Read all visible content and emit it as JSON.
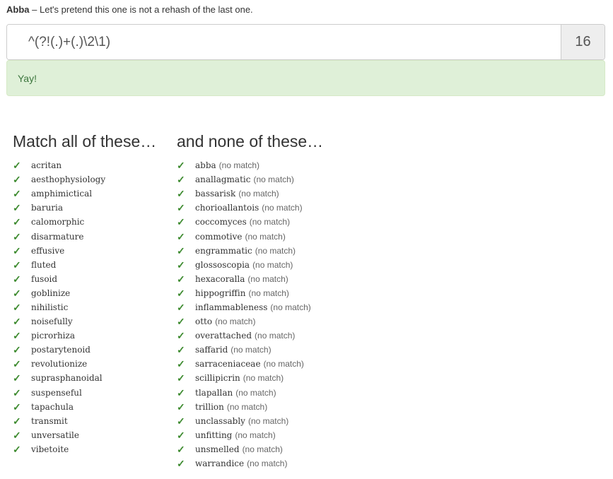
{
  "puzzle": {
    "name": "Abba",
    "separator": "–",
    "description": "Let's pretend this one is not a rehash of the last one."
  },
  "regex": {
    "value": "^(?!(.)+(.)\\2\\1)",
    "length": "16"
  },
  "status": {
    "message": "Yay!"
  },
  "match_column": {
    "heading": "Match all of these…",
    "words": [
      "acritan",
      "aesthophysiology",
      "amphimictical",
      "baruria",
      "calomorphic",
      "disarmature",
      "effusive",
      "fluted",
      "fusoid",
      "goblinize",
      "nihilistic",
      "noisefully",
      "picrorhiza",
      "postarytenoid",
      "revolutionize",
      "suprasphanoidal",
      "suspenseful",
      "tapachula",
      "transmit",
      "unversatile",
      "vibetoite"
    ]
  },
  "nomatch_column": {
    "heading": "and none of these…",
    "note": "(no match)",
    "words": [
      "abba",
      "anallagmatic",
      "bassarisk",
      "chorioallantois",
      "coccomyces",
      "commotive",
      "engrammatic",
      "glossoscopia",
      "hexacoralla",
      "hippogriffin",
      "inflammableness",
      "otto",
      "overattached",
      "saffarid",
      "sarraceniaceae",
      "scillipicrin",
      "tlapallan",
      "trillion",
      "unclassably",
      "unfitting",
      "unsmelled",
      "warrandice"
    ]
  },
  "icons": {
    "check": "✓",
    "check_color": "#3c8a2e"
  },
  "colors": {
    "success_bg": "#dff0d8",
    "success_text": "#3c763d",
    "addon_bg": "#eeeeee"
  }
}
